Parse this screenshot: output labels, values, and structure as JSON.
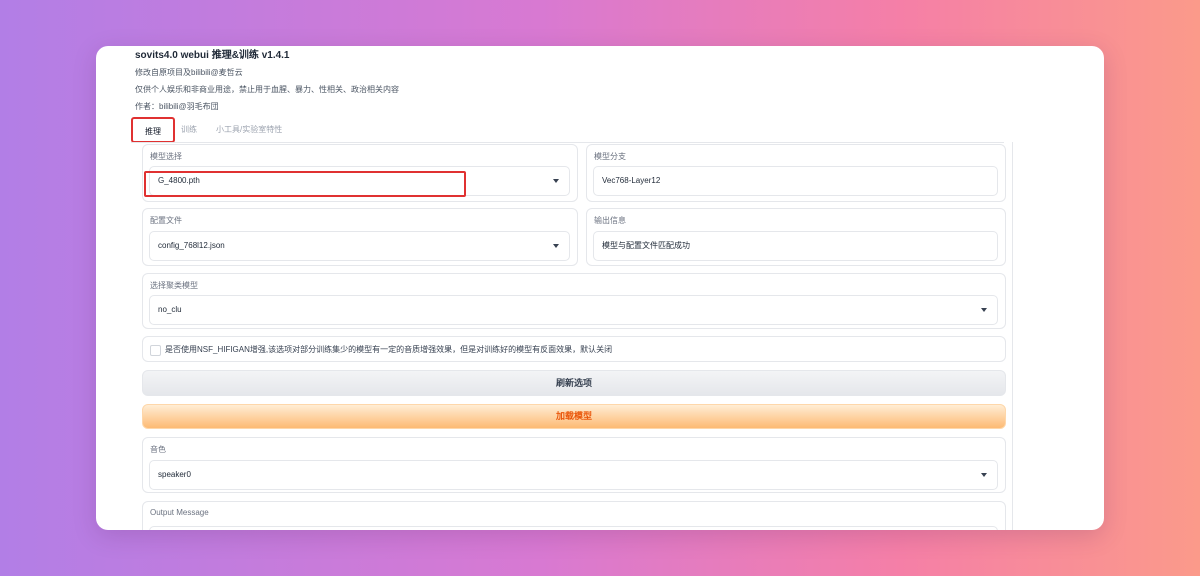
{
  "header": {
    "title": "sovits4.0 webui 推理&训练 v1.4.1",
    "lines": [
      "修改自原项目及bilibili@麦哲云",
      "仅供个人娱乐和非商业用途，禁止用于血腥、暴力、性相关、政治相关内容",
      "作者：bilibili@羽毛布団"
    ]
  },
  "tabs": [
    "推理",
    "训练",
    "小工具/实验室特性"
  ],
  "model_select": {
    "label": "模型选择",
    "value": "G_4800.pth"
  },
  "model_branch": {
    "label": "模型分支",
    "value": "Vec768-Layer12"
  },
  "config_file": {
    "label": "配置文件",
    "value": "config_768l12.json"
  },
  "output_info": {
    "label": "输出信息",
    "value": "模型与配置文件匹配成功"
  },
  "cluster_model": {
    "label": "选择聚类模型",
    "value": "no_clu"
  },
  "nsf_checkbox": {
    "label": "是否使用NSF_HIFIGAN增强,该选项对部分训练集少的模型有一定的音质增强效果，但是对训练好的模型有反面效果，默认关闭",
    "checked": false
  },
  "buttons": {
    "refresh": "刷新选项",
    "load": "加载模型"
  },
  "speaker": {
    "label": "音色",
    "value": "speaker0"
  },
  "output_message": {
    "label": "Output Message"
  },
  "colors": {
    "highlight": "#e03131",
    "primary_text": "#ea580c",
    "primary_bg": "#fdba74"
  }
}
